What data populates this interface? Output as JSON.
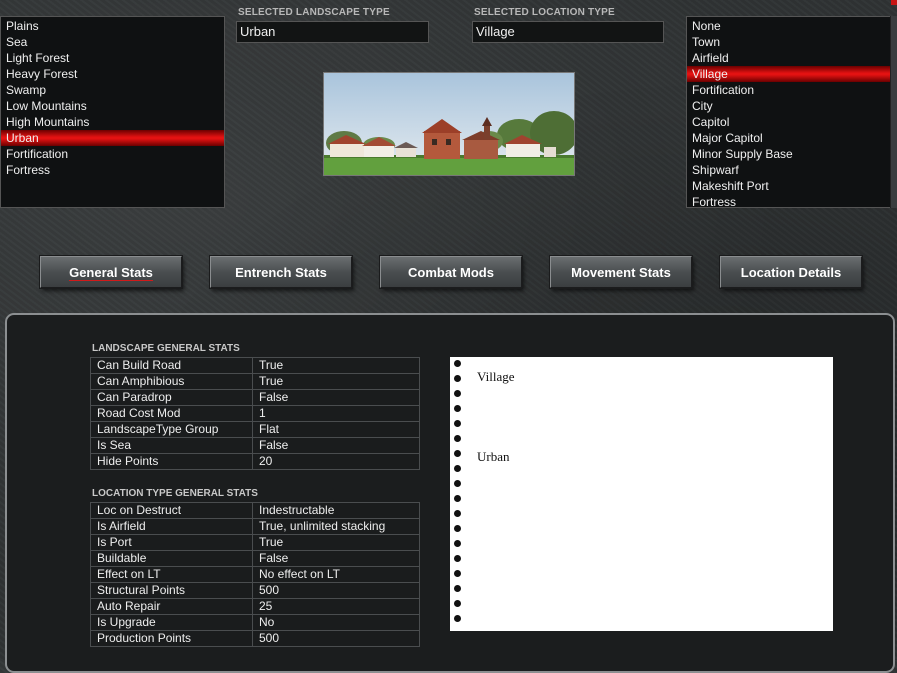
{
  "landscape_list": {
    "items": [
      "Plains",
      "Sea",
      "Light Forest",
      "Heavy Forest",
      "Swamp",
      "Low Mountains",
      "High Mountains",
      "Urban",
      "Fortification",
      "Fortress"
    ],
    "selected_index": 7
  },
  "location_list": {
    "items": [
      "None",
      "Town",
      "Airfield",
      "Village",
      "Fortification",
      "City",
      "Capitol",
      "Major Capitol",
      "Minor Supply Base",
      "Shipwarf",
      "Makeshift Port",
      "Fortress"
    ],
    "selected_index": 3
  },
  "selected_landscape": {
    "label": "SELECTED LANDSCAPE TYPE",
    "value": "Urban"
  },
  "selected_location": {
    "label": "SELECTED LOCATION TYPE",
    "value": "Village"
  },
  "tabs": [
    {
      "label": "General Stats",
      "active": true
    },
    {
      "label": "Entrench Stats",
      "active": false
    },
    {
      "label": "Combat Mods",
      "active": false
    },
    {
      "label": "Movement Stats",
      "active": false
    },
    {
      "label": "Location Details",
      "active": false
    }
  ],
  "landscape_stats": {
    "title": "LANDSCAPE GENERAL STATS",
    "rows": [
      [
        "Can Build Road",
        "True"
      ],
      [
        "Can Amphibious",
        "True"
      ],
      [
        "Can Paradrop",
        "False"
      ],
      [
        "Road Cost Mod",
        "1"
      ],
      [
        "LandscapeType Group",
        "Flat"
      ],
      [
        "Is Sea",
        "False"
      ],
      [
        "Hide Points",
        "20"
      ]
    ]
  },
  "location_stats": {
    "title": "LOCATION TYPE GENERAL STATS",
    "rows": [
      [
        "Loc on Destruct",
        "Indestructable"
      ],
      [
        "Is Airfield",
        "True, unlimited stacking"
      ],
      [
        "Is Port",
        "True"
      ],
      [
        "Buildable",
        "False"
      ],
      [
        "Effect on LT",
        "No effect on LT"
      ],
      [
        "Structural Points",
        "500"
      ],
      [
        "Auto Repair",
        "25"
      ],
      [
        "Is Upgrade",
        "No"
      ],
      [
        "Production Points",
        "500"
      ]
    ]
  },
  "notebook": {
    "line1": "Village",
    "line2": "Urban"
  },
  "colors": {
    "accent_red": "#e31212",
    "panel_border": "#8c8f91"
  }
}
